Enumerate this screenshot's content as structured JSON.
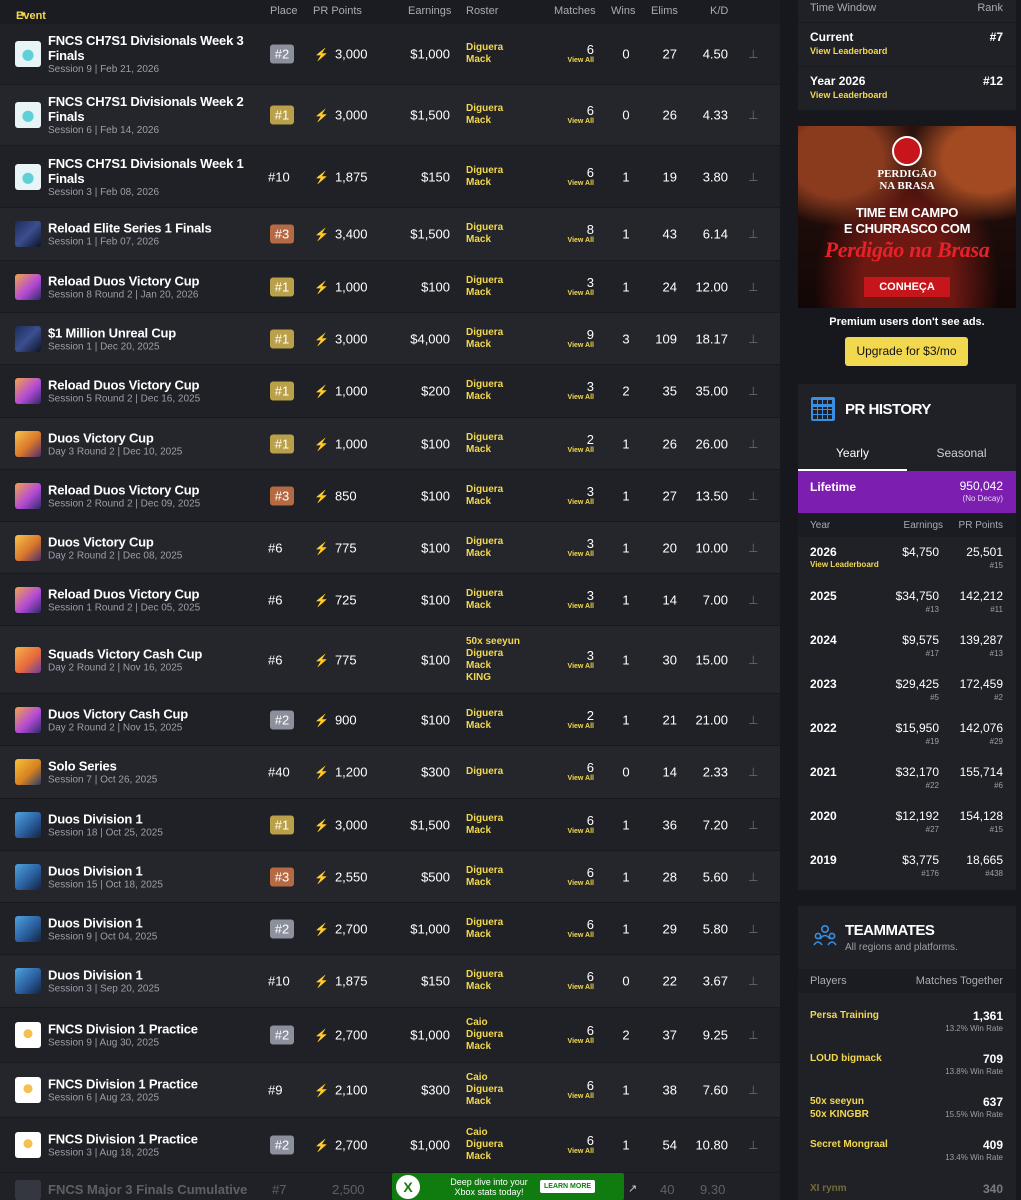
{
  "table": {
    "headers": {
      "event": "Event",
      "place": "Place",
      "pr_points": "PR Points",
      "earnings": "Earnings",
      "roster": "Roster",
      "matches": "Matches",
      "wins": "Wins",
      "elims": "Elims",
      "kd": "K/D"
    },
    "view_all": "View All",
    "rows": [
      {
        "title": [
          "FNCS CH7S1 Divisionals Week 3",
          "Finals"
        ],
        "sub": "Session 9 | Feb 21, 2026",
        "place": "#2",
        "badge": "silver",
        "pr": "3,000",
        "earnings": "$1,000",
        "roster": [
          "Diguera",
          "Mack"
        ],
        "matches": "6",
        "wins": "0",
        "elims": "27",
        "kd": "4.50",
        "thumb": "fncs"
      },
      {
        "title": [
          "FNCS CH7S1 Divisionals Week 2",
          "Finals"
        ],
        "sub": "Session 6 | Feb 14, 2026",
        "place": "#1",
        "badge": "gold",
        "pr": "3,000",
        "earnings": "$1,500",
        "roster": [
          "Diguera",
          "Mack"
        ],
        "matches": "6",
        "wins": "0",
        "elims": "26",
        "kd": "4.33",
        "thumb": "fncs"
      },
      {
        "title": [
          "FNCS CH7S1 Divisionals Week 1",
          "Finals"
        ],
        "sub": "Session 3 | Feb 08, 2026",
        "place": "#10",
        "badge": "none",
        "pr": "1,875",
        "earnings": "$150",
        "roster": [
          "Diguera",
          "Mack"
        ],
        "matches": "6",
        "wins": "1",
        "elims": "19",
        "kd": "3.80",
        "thumb": "fncs"
      },
      {
        "title": [
          "Reload Elite Series 1 Finals"
        ],
        "sub": "Session 1 | Feb 07, 2026",
        "place": "#3",
        "badge": "bronze",
        "pr": "3,400",
        "earnings": "$1,500",
        "roster": [
          "Diguera",
          "Mack"
        ],
        "matches": "8",
        "wins": "1",
        "elims": "43",
        "kd": "6.14",
        "thumb": "elite"
      },
      {
        "title": [
          "Reload Duos Victory Cup"
        ],
        "sub": "Session 8 Round 2 | Jan 20, 2026",
        "place": "#1",
        "badge": "gold",
        "pr": "1,000",
        "earnings": "$100",
        "roster": [
          "Diguera",
          "Mack"
        ],
        "matches": "3",
        "wins": "1",
        "elims": "24",
        "kd": "12.00",
        "thumb": "reload"
      },
      {
        "title": [
          "$1 Million Unreal Cup"
        ],
        "sub": "Session 1 | Dec 20, 2025",
        "place": "#1",
        "badge": "gold",
        "pr": "3,000",
        "earnings": "$4,000",
        "roster": [
          "Diguera",
          "Mack"
        ],
        "matches": "9",
        "wins": "3",
        "elims": "109",
        "kd": "18.17",
        "thumb": "elite"
      },
      {
        "title": [
          "Reload Duos Victory Cup"
        ],
        "sub": "Session 5 Round 2 | Dec 16, 2025",
        "place": "#1",
        "badge": "gold",
        "pr": "1,000",
        "earnings": "$200",
        "roster": [
          "Diguera",
          "Mack"
        ],
        "matches": "3",
        "wins": "2",
        "elims": "35",
        "kd": "35.00",
        "thumb": "reload"
      },
      {
        "title": [
          "Duos Victory Cup"
        ],
        "sub": "Day 3 Round 2 | Dec 10, 2025",
        "place": "#1",
        "badge": "gold",
        "pr": "1,000",
        "earnings": "$100",
        "roster": [
          "Diguera",
          "Mack"
        ],
        "matches": "2",
        "wins": "1",
        "elims": "26",
        "kd": "26.00",
        "thumb": "duos"
      },
      {
        "title": [
          "Reload Duos Victory Cup"
        ],
        "sub": "Session 2 Round 2 | Dec 09, 2025",
        "place": "#3",
        "badge": "bronze",
        "pr": "850",
        "earnings": "$100",
        "roster": [
          "Diguera",
          "Mack"
        ],
        "matches": "3",
        "wins": "1",
        "elims": "27",
        "kd": "13.50",
        "thumb": "reload"
      },
      {
        "title": [
          "Duos Victory Cup"
        ],
        "sub": "Day 2 Round 2 | Dec 08, 2025",
        "place": "#6",
        "badge": "none",
        "pr": "775",
        "earnings": "$100",
        "roster": [
          "Diguera",
          "Mack"
        ],
        "matches": "3",
        "wins": "1",
        "elims": "20",
        "kd": "10.00",
        "thumb": "duos"
      },
      {
        "title": [
          "Reload Duos Victory Cup"
        ],
        "sub": "Session 1 Round 2 | Dec 05, 2025",
        "place": "#6",
        "badge": "none",
        "pr": "725",
        "earnings": "$100",
        "roster": [
          "Diguera",
          "Mack"
        ],
        "matches": "3",
        "wins": "1",
        "elims": "14",
        "kd": "7.00",
        "thumb": "reload"
      },
      {
        "title": [
          "Squads Victory Cash Cup"
        ],
        "sub": "Day 2 Round 2 | Nov 16, 2025",
        "place": "#6",
        "badge": "none",
        "pr": "775",
        "earnings": "$100",
        "roster": [
          "50x seeyun",
          "Diguera",
          "Mack",
          "KING"
        ],
        "matches": "3",
        "wins": "1",
        "elims": "30",
        "kd": "15.00",
        "thumb": "squads"
      },
      {
        "title": [
          "Duos Victory Cash Cup"
        ],
        "sub": "Day 2 Round 2 | Nov 15, 2025",
        "place": "#2",
        "badge": "silver",
        "pr": "900",
        "earnings": "$100",
        "roster": [
          "Diguera",
          "Mack"
        ],
        "matches": "2",
        "wins": "1",
        "elims": "21",
        "kd": "21.00",
        "thumb": "reload"
      },
      {
        "title": [
          "Solo Series"
        ],
        "sub": "Session 7 | Oct 26, 2025",
        "place": "#40",
        "badge": "none",
        "pr": "1,200",
        "earnings": "$300",
        "roster": [
          "Diguera"
        ],
        "matches": "6",
        "wins": "0",
        "elims": "14",
        "kd": "2.33",
        "thumb": "solo"
      },
      {
        "title": [
          "Duos Division 1"
        ],
        "sub": "Session 18 | Oct 25, 2025",
        "place": "#1",
        "badge": "gold",
        "pr": "3,000",
        "earnings": "$1,500",
        "roster": [
          "Diguera",
          "Mack"
        ],
        "matches": "6",
        "wins": "1",
        "elims": "36",
        "kd": "7.20",
        "thumb": "division"
      },
      {
        "title": [
          "Duos Division 1"
        ],
        "sub": "Session 15 | Oct 18, 2025",
        "place": "#3",
        "badge": "bronze",
        "pr": "2,550",
        "earnings": "$500",
        "roster": [
          "Diguera",
          "Mack"
        ],
        "matches": "6",
        "wins": "1",
        "elims": "28",
        "kd": "5.60",
        "thumb": "division"
      },
      {
        "title": [
          "Duos Division 1"
        ],
        "sub": "Session 9 | Oct 04, 2025",
        "place": "#2",
        "badge": "silver",
        "pr": "2,700",
        "earnings": "$1,000",
        "roster": [
          "Diguera",
          "Mack"
        ],
        "matches": "6",
        "wins": "1",
        "elims": "29",
        "kd": "5.80",
        "thumb": "division"
      },
      {
        "title": [
          "Duos Division 1"
        ],
        "sub": "Session 3 | Sep 20, 2025",
        "place": "#10",
        "badge": "none",
        "pr": "1,875",
        "earnings": "$150",
        "roster": [
          "Diguera",
          "Mack"
        ],
        "matches": "6",
        "wins": "0",
        "elims": "22",
        "kd": "3.67",
        "thumb": "division"
      },
      {
        "title": [
          "FNCS Division 1 Practice"
        ],
        "sub": "Session 9 | Aug 30, 2025",
        "place": "#2",
        "badge": "silver",
        "pr": "2,700",
        "earnings": "$1,000",
        "roster": [
          "Caio",
          "Diguera",
          "Mack"
        ],
        "matches": "6",
        "wins": "2",
        "elims": "37",
        "kd": "9.25",
        "thumb": "practice"
      },
      {
        "title": [
          "FNCS Division 1 Practice"
        ],
        "sub": "Session 6 | Aug 23, 2025",
        "place": "#9",
        "badge": "none",
        "pr": "2,100",
        "earnings": "$300",
        "roster": [
          "Caio",
          "Diguera",
          "Mack"
        ],
        "matches": "6",
        "wins": "1",
        "elims": "38",
        "kd": "7.60",
        "thumb": "practice"
      },
      {
        "title": [
          "FNCS Division 1 Practice"
        ],
        "sub": "Session 3 | Aug 18, 2025",
        "place": "#2",
        "badge": "silver",
        "pr": "2,700",
        "earnings": "$1,000",
        "roster": [
          "Caio",
          "Diguera",
          "Mack"
        ],
        "matches": "6",
        "wins": "1",
        "elims": "54",
        "kd": "10.80",
        "thumb": "practice"
      }
    ],
    "partial_row": {
      "title": "FNCS Major 3 Finals Cumulative",
      "place": "#7",
      "pr": "2,500",
      "elims": "40",
      "kd": "9.30"
    }
  },
  "xbox_ad": {
    "text": "Deep dive into your Xbox stats today!",
    "button": "LEARN MORE",
    "logo": "xbox-logo-icon"
  },
  "time_window": {
    "header_left": "Time Window",
    "header_right": "Rank",
    "rows": [
      {
        "label": "Current",
        "link": "View Leaderboard",
        "rank": "#7"
      },
      {
        "label": "Year 2026",
        "link": "View Leaderboard",
        "rank": "#12"
      }
    ]
  },
  "food_ad": {
    "brand_1": "PERDIGÃO",
    "brand_2": "NA BRASA",
    "line_1": "TIME EM CAMPO",
    "line_2": "E CHURRASCO COM",
    "line_3": "Perdigão na Brasa",
    "cta": "CONHEÇA"
  },
  "premium": {
    "text": "Premium users don't see ads.",
    "button": "Upgrade for $3/mo"
  },
  "pr_history": {
    "title": "PR HISTORY",
    "tabs": [
      "Yearly",
      "Seasonal"
    ],
    "active_tab": "Yearly",
    "lifetime": {
      "label": "Lifetime",
      "value": "950,042",
      "note": "(No Decay)"
    },
    "headers": {
      "year": "Year",
      "earnings": "Earnings",
      "points": "PR Points"
    },
    "rows": [
      {
        "year": "2026",
        "link": "View Leaderboard",
        "earnings": "$4,750",
        "earn_rank": "",
        "points": "25,501",
        "points_rank": "#15"
      },
      {
        "year": "2025",
        "link": "",
        "earnings": "$34,750",
        "earn_rank": "#13",
        "points": "142,212",
        "points_rank": "#11"
      },
      {
        "year": "2024",
        "link": "",
        "earnings": "$9,575",
        "earn_rank": "#17",
        "points": "139,287",
        "points_rank": "#13"
      },
      {
        "year": "2023",
        "link": "",
        "earnings": "$29,425",
        "earn_rank": "#5",
        "points": "172,459",
        "points_rank": "#2"
      },
      {
        "year": "2022",
        "link": "",
        "earnings": "$15,950",
        "earn_rank": "#19",
        "points": "142,076",
        "points_rank": "#29"
      },
      {
        "year": "2021",
        "link": "",
        "earnings": "$32,170",
        "earn_rank": "#22",
        "points": "155,714",
        "points_rank": "#6"
      },
      {
        "year": "2020",
        "link": "",
        "earnings": "$12,192",
        "earn_rank": "#27",
        "points": "154,128",
        "points_rank": "#15"
      },
      {
        "year": "2019",
        "link": "",
        "earnings": "$3,775",
        "earn_rank": "#176",
        "points": "18,665",
        "points_rank": "#438"
      }
    ]
  },
  "teammates": {
    "title": "TEAMMATES",
    "subtitle": "All regions and platforms.",
    "headers": {
      "players": "Players",
      "together": "Matches Together"
    },
    "rows": [
      {
        "players": [
          "Persa Training"
        ],
        "count": "1,361",
        "rate": "13.2% Win Rate"
      },
      {
        "players": [
          "LOUD bigmack"
        ],
        "count": "709",
        "rate": "13.8% Win Rate"
      },
      {
        "players": [
          "50x seeyun",
          "50x KINGBR"
        ],
        "count": "637",
        "rate": "15.5% Win Rate"
      },
      {
        "players": [
          "Secret Mongraal"
        ],
        "count": "409",
        "rate": "13.4% Win Rate"
      },
      {
        "players": [
          "XI rynm"
        ],
        "count": "340",
        "rate": ""
      }
    ]
  },
  "colors": {
    "accent": "#f2d84f",
    "purple": "#7c1fb0",
    "gold": "#b9a049",
    "silver": "#8c8f9c",
    "bronze": "#b66a43"
  }
}
